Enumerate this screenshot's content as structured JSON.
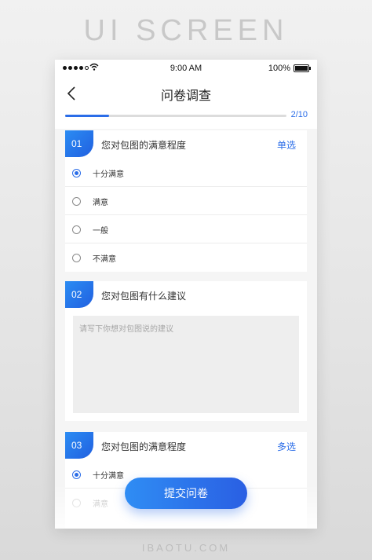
{
  "poster": {
    "title": "UI SCREEN",
    "footer": "IBAOTU.COM"
  },
  "status_bar": {
    "time": "9:00 AM",
    "battery": "100%"
  },
  "nav": {
    "title": "问卷调查"
  },
  "progress": {
    "current": 2,
    "total": 10,
    "label": "2/10",
    "fraction": 0.2
  },
  "questions": [
    {
      "number": "01",
      "title": "您对包图的满意程度",
      "type_label": "单选",
      "options": [
        {
          "label": "十分满意",
          "selected": true
        },
        {
          "label": "满意",
          "selected": false
        },
        {
          "label": "一般",
          "selected": false
        },
        {
          "label": "不满意",
          "selected": false
        }
      ]
    },
    {
      "number": "02",
      "title": "您对包图有什么建议",
      "placeholder": "请写下你想对包图说的建议"
    },
    {
      "number": "03",
      "title": "您对包图的满意程度",
      "type_label": "多选",
      "options": [
        {
          "label": "十分满意",
          "selected": true
        },
        {
          "label": "满意",
          "selected": false
        }
      ]
    }
  ],
  "submit": {
    "label": "提交问卷"
  },
  "colors": {
    "accent": "#2b6de8",
    "accent_light": "#2f8df4",
    "background": "#f5f5f5"
  }
}
